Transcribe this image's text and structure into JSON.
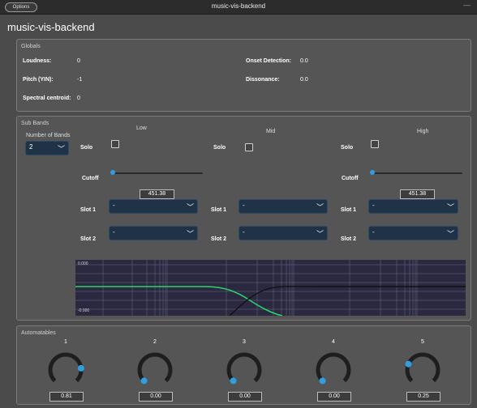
{
  "window": {
    "options_label": "Options",
    "title": "music-vis-backend",
    "minimize": "—"
  },
  "app_title": "music-vis-backend",
  "globals": {
    "label": "Globals",
    "loudness_label": "Loudness:",
    "loudness_value": "0",
    "pitch_label": "Pitch (YIN):",
    "pitch_value": "-1",
    "centroid_label": "Spectral centroid:",
    "centroid_value": "0",
    "onset_label": "Onset Detection:",
    "onset_value": "0.0",
    "dissonance_label": "Dissonance:",
    "dissonance_value": "0.0"
  },
  "subbands": {
    "label": "Sub Bands",
    "num_bands_label": "Number of Bands",
    "num_bands_value": "2",
    "solo_label": "Solo",
    "cutoff_label": "Cutoff",
    "slot1_label": "Slot 1",
    "slot2_label": "Slot 2",
    "bands": [
      {
        "name": "Low",
        "cutoff_value": "451.38",
        "slot1": "-",
        "slot2": "-"
      },
      {
        "name": "Mid",
        "slot1": "-",
        "slot2": "-"
      },
      {
        "name": "High",
        "cutoff_value": "451.38",
        "slot1": "-",
        "slot2": "-"
      }
    ],
    "graph": {
      "top_label": "0.000",
      "bottom_label": "-0.000",
      "low_color": "#2bd46a",
      "high_color": "#111111"
    }
  },
  "automatables": {
    "label": "Automatables",
    "accent": "#2f9fe0",
    "knobs": [
      {
        "number": "1",
        "value": "0.81",
        "level": 0.81
      },
      {
        "number": "2",
        "value": "0.00",
        "level": 0.0
      },
      {
        "number": "3",
        "value": "0.00",
        "level": 0.0
      },
      {
        "number": "4",
        "value": "0.00",
        "level": 0.0
      },
      {
        "number": "5",
        "value": "0.25",
        "level": 0.25
      }
    ]
  }
}
